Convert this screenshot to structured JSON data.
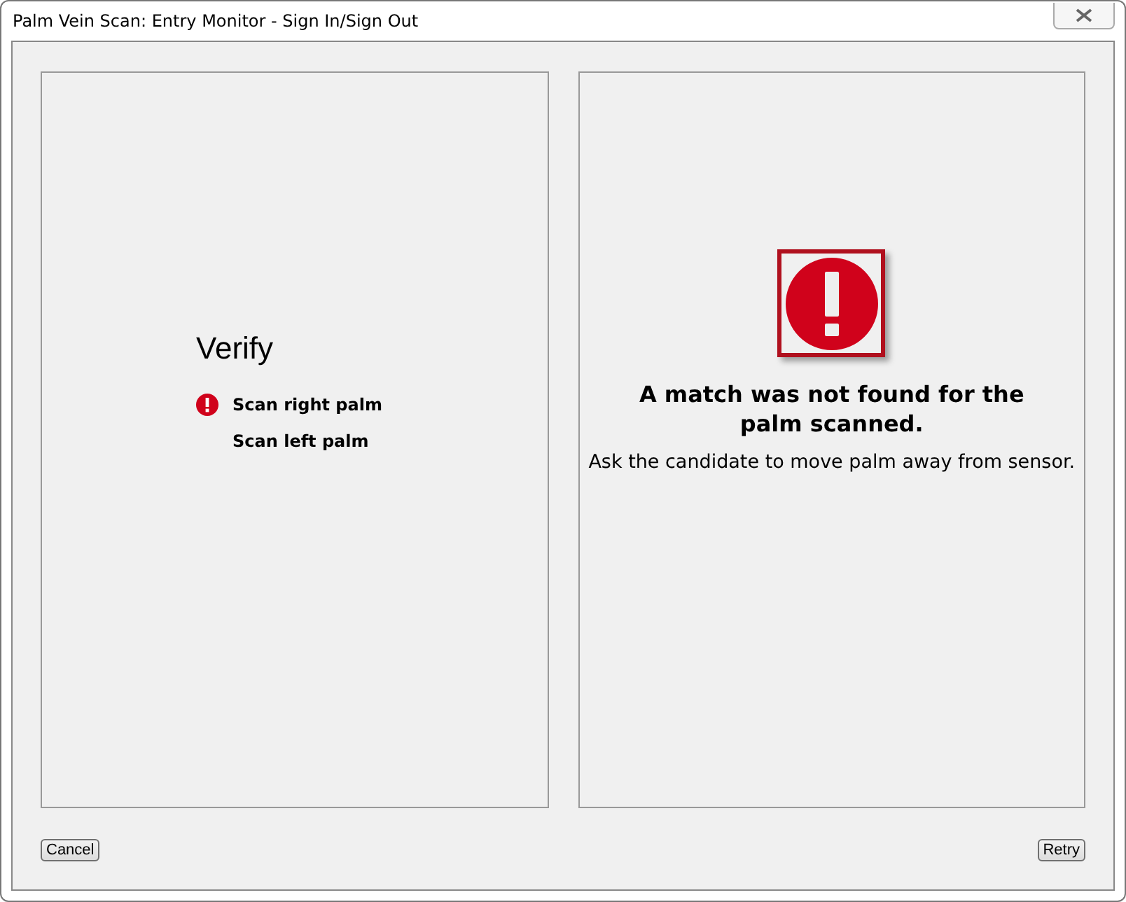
{
  "window": {
    "title": "Palm Vein Scan: Entry Monitor - Sign In/Sign Out"
  },
  "verify": {
    "title": "Verify",
    "steps": [
      {
        "label": "Scan right palm",
        "failed": true
      },
      {
        "label": "Scan left palm",
        "failed": false
      }
    ]
  },
  "result": {
    "heading": "A match was not found for the palm scanned.",
    "instruction": "Ask the candidate to move palm away from sensor."
  },
  "buttons": {
    "cancel": "Cancel",
    "retry": "Retry"
  }
}
